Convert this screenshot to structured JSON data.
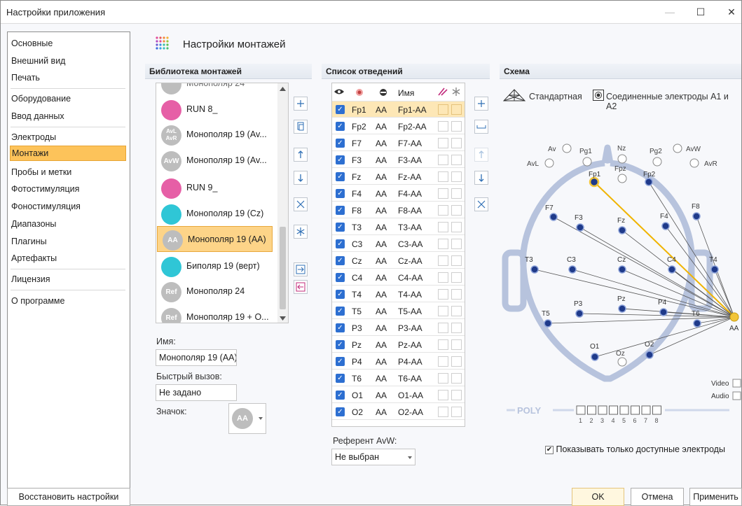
{
  "window": {
    "title": "Настройки приложения",
    "minimize": "—",
    "maximize": "☐",
    "close": "✕"
  },
  "sidebar": {
    "items": [
      {
        "label": "Основные"
      },
      {
        "label": "Внешний вид"
      },
      {
        "label": "Печать"
      },
      {
        "label": "Оборудование"
      },
      {
        "label": "Ввод данных"
      },
      {
        "label": "Электроды"
      },
      {
        "label": "Монтажи",
        "selected": true
      },
      {
        "label": "Пробы и метки"
      },
      {
        "label": "Фотостимуляция"
      },
      {
        "label": "Фоностимуляция"
      },
      {
        "label": "Диапазоны"
      },
      {
        "label": "Плагины"
      },
      {
        "label": "Артефакты"
      },
      {
        "label": "Лицензия"
      },
      {
        "label": "О программе"
      }
    ],
    "restore_label": "Восстановить настройки"
  },
  "page": {
    "title": "Настройки монтажей"
  },
  "library": {
    "header": "Библиотека монтажей",
    "partial_item": "Монополяр 24",
    "items": [
      {
        "label": "RUN 8_",
        "icon": "pink-dots-icon"
      },
      {
        "label": "Монополяр 19 (Av...",
        "icon_text": "AvL AvR"
      },
      {
        "label": "Монополяр 19 (Av...",
        "icon_text": "AvW"
      },
      {
        "label": "RUN 9_",
        "icon": "pink-dots-icon"
      },
      {
        "label": "Монополяр 19 (Cz)",
        "icon": "cyan-dots-icon"
      },
      {
        "label": "Монополяр 19 (AA)",
        "icon_text": "AA",
        "selected": true
      },
      {
        "label": "Биполяр 19 (верт)",
        "icon": "cyan-grid-icon"
      },
      {
        "label": "Монополяр 24",
        "icon_text": "Ref"
      },
      {
        "label": "Монополяр 19 + O...",
        "icon_text": "Ref"
      }
    ],
    "name_label": "Имя:",
    "name_value": "Монополяр 19 (AA)",
    "hotkey_label": "Быстрый вызов:",
    "hotkey_value": "Не задано",
    "icon_label": "Значок:",
    "icon_value": "AA"
  },
  "leads": {
    "header": "Список отведений",
    "col_name": "Имя",
    "rows": [
      {
        "e1": "Fp1",
        "e2": "AA",
        "name": "Fp1-AA",
        "selected": true
      },
      {
        "e1": "Fp2",
        "e2": "AA",
        "name": "Fp2-AA"
      },
      {
        "e1": "F7",
        "e2": "AA",
        "name": "F7-AA"
      },
      {
        "e1": "F3",
        "e2": "AA",
        "name": "F3-AA"
      },
      {
        "e1": "Fz",
        "e2": "AA",
        "name": "Fz-AA"
      },
      {
        "e1": "F4",
        "e2": "AA",
        "name": "F4-AA"
      },
      {
        "e1": "F8",
        "e2": "AA",
        "name": "F8-AA"
      },
      {
        "e1": "T3",
        "e2": "AA",
        "name": "T3-AA"
      },
      {
        "e1": "C3",
        "e2": "AA",
        "name": "C3-AA"
      },
      {
        "e1": "Cz",
        "e2": "AA",
        "name": "Cz-AA"
      },
      {
        "e1": "C4",
        "e2": "AA",
        "name": "C4-AA"
      },
      {
        "e1": "T4",
        "e2": "AA",
        "name": "T4-AA"
      },
      {
        "e1": "T5",
        "e2": "AA",
        "name": "T5-AA"
      },
      {
        "e1": "P3",
        "e2": "AA",
        "name": "P3-AA"
      },
      {
        "e1": "Pz",
        "e2": "AA",
        "name": "Pz-AA"
      },
      {
        "e1": "P4",
        "e2": "AA",
        "name": "P4-AA"
      },
      {
        "e1": "T6",
        "e2": "AA",
        "name": "T6-AA"
      },
      {
        "e1": "O1",
        "e2": "AA",
        "name": "O1-AA"
      },
      {
        "e1": "O2",
        "e2": "AA",
        "name": "O2-AA"
      }
    ],
    "referent_label": "Референт AvW:",
    "referent_value": "Не выбран"
  },
  "scheme": {
    "header": "Схема",
    "standard_label": "Стандартная",
    "connected_label": "Соединенные электроды А1 и А2",
    "electrodes": [
      "Fp1",
      "Fp2",
      "F7",
      "F3",
      "Fz",
      "F4",
      "F8",
      "T3",
      "C3",
      "Cz",
      "C4",
      "T4",
      "T5",
      "P3",
      "Pz",
      "P4",
      "T6",
      "O1",
      "O2"
    ],
    "reference_label": "AA",
    "aux": [
      "Av",
      "Pg1",
      "Nz",
      "Pg2",
      "AvW",
      "AvL",
      "Fpz",
      "AvR",
      "Oz"
    ],
    "video_label": "Video",
    "audio_label": "Audio",
    "poly_label": "POLY",
    "poly_numbers": [
      "1",
      "2",
      "3",
      "4",
      "5",
      "6",
      "7",
      "8"
    ],
    "show_only_label": "Показывать только доступные электроды"
  },
  "buttons": {
    "ok": "OK",
    "cancel": "Отмена",
    "apply": "Применить"
  },
  "colors": {
    "accent": "#fdc35a",
    "selected_line": "#f0b400",
    "head": "#b7c3dd",
    "electrode": "#1f3a8a"
  }
}
